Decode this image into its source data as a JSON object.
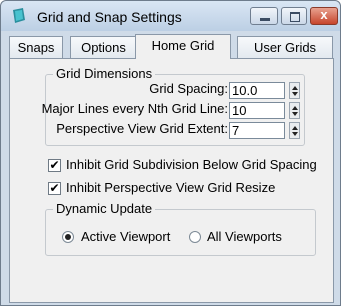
{
  "window": {
    "title": "Grid and Snap Settings",
    "close_glyph": "x"
  },
  "tabs": [
    {
      "label": "Snaps",
      "active": false
    },
    {
      "label": "Options",
      "active": false
    },
    {
      "label": "Home Grid",
      "active": true
    },
    {
      "label": "User Grids",
      "active": false
    }
  ],
  "grid_dimensions": {
    "title": "Grid Dimensions",
    "grid_spacing_label": "Grid Spacing:",
    "grid_spacing_value": "10.0",
    "major_lines_label": "Major Lines every Nth Grid Line:",
    "major_lines_value": "10",
    "perspective_extent_label": "Perspective View Grid Extent:",
    "perspective_extent_value": "7"
  },
  "options": {
    "inhibit_subdivision_label": "Inhibit Grid Subdivision Below Grid Spacing",
    "inhibit_subdivision_checked": true,
    "inhibit_perspective_label": "Inhibit Perspective View Grid Resize",
    "inhibit_perspective_checked": true,
    "check_glyph": "✔"
  },
  "dynamic_update": {
    "title": "Dynamic Update",
    "active_viewport_label": "Active Viewport",
    "all_viewports_label": "All Viewports",
    "selected": "active_viewport"
  }
}
